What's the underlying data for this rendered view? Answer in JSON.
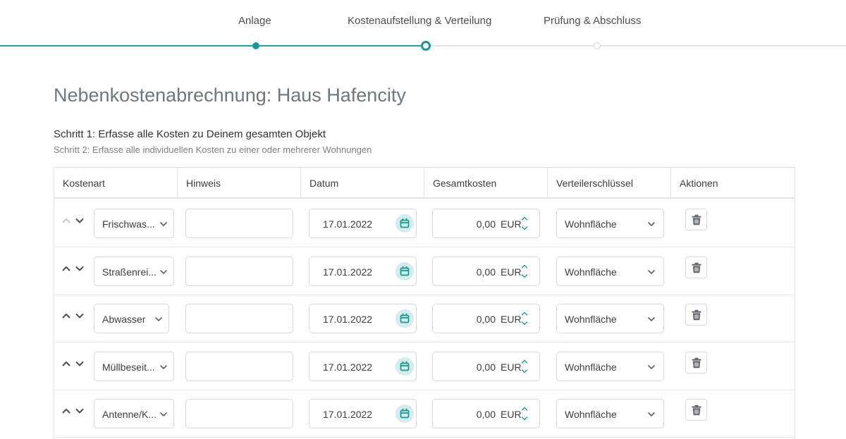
{
  "stepper": {
    "steps": [
      {
        "label": "Anlage",
        "state": "done"
      },
      {
        "label": "Kostenaufstellung & Verteilung",
        "state": "current"
      },
      {
        "label": "Prüfung & Abschluss",
        "state": "todo"
      }
    ],
    "accent_color": "#1a9a94"
  },
  "page": {
    "title": "Nebenkostenabrechnung: Haus Hafencity",
    "step1": "Schritt 1: Erfasse alle Kosten zu Deinem gesamten Objekt",
    "step2": "Schritt 2: Erfasse alle individuellen Kosten zu einer oder mehrerer Wohnungen"
  },
  "table": {
    "headers": [
      "Kostenart",
      "Hinweis",
      "Datum",
      "Gesamtkosten",
      "Verteilerschlüssel",
      "Aktionen"
    ],
    "rows": [
      {
        "kostenart": "Frischwas...",
        "hinweis": "",
        "datum": "17.01.2022",
        "betrag": "0,00",
        "waehrung": "EUR",
        "verteilerschluessel": "Wohnfläche",
        "up_enabled": false
      },
      {
        "kostenart": "Straßenrei...",
        "hinweis": "",
        "datum": "17.01.2022",
        "betrag": "0,00",
        "waehrung": "EUR",
        "verteilerschluessel": "Wohnfläche",
        "up_enabled": true
      },
      {
        "kostenart": "Abwasser",
        "hinweis": "",
        "datum": "17.01.2022",
        "betrag": "0,00",
        "waehrung": "EUR",
        "verteilerschluessel": "Wohnfläche",
        "up_enabled": true
      },
      {
        "kostenart": "Müllbeseit...",
        "hinweis": "",
        "datum": "17.01.2022",
        "betrag": "0,00",
        "waehrung": "EUR",
        "verteilerschluessel": "Wohnfläche",
        "up_enabled": true
      },
      {
        "kostenart": "Antenne/K...",
        "hinweis": "",
        "datum": "17.01.2022",
        "betrag": "0,00",
        "waehrung": "EUR",
        "verteilerschluessel": "Wohnfläche",
        "up_enabled": true
      }
    ],
    "icons": {
      "move_up": "chevron-up-icon",
      "move_down": "chevron-down-icon",
      "dropdown": "chevron-down-icon",
      "calendar": "calendar-icon",
      "spinner": "spinner-arrows-icon",
      "delete": "trash-icon"
    }
  }
}
